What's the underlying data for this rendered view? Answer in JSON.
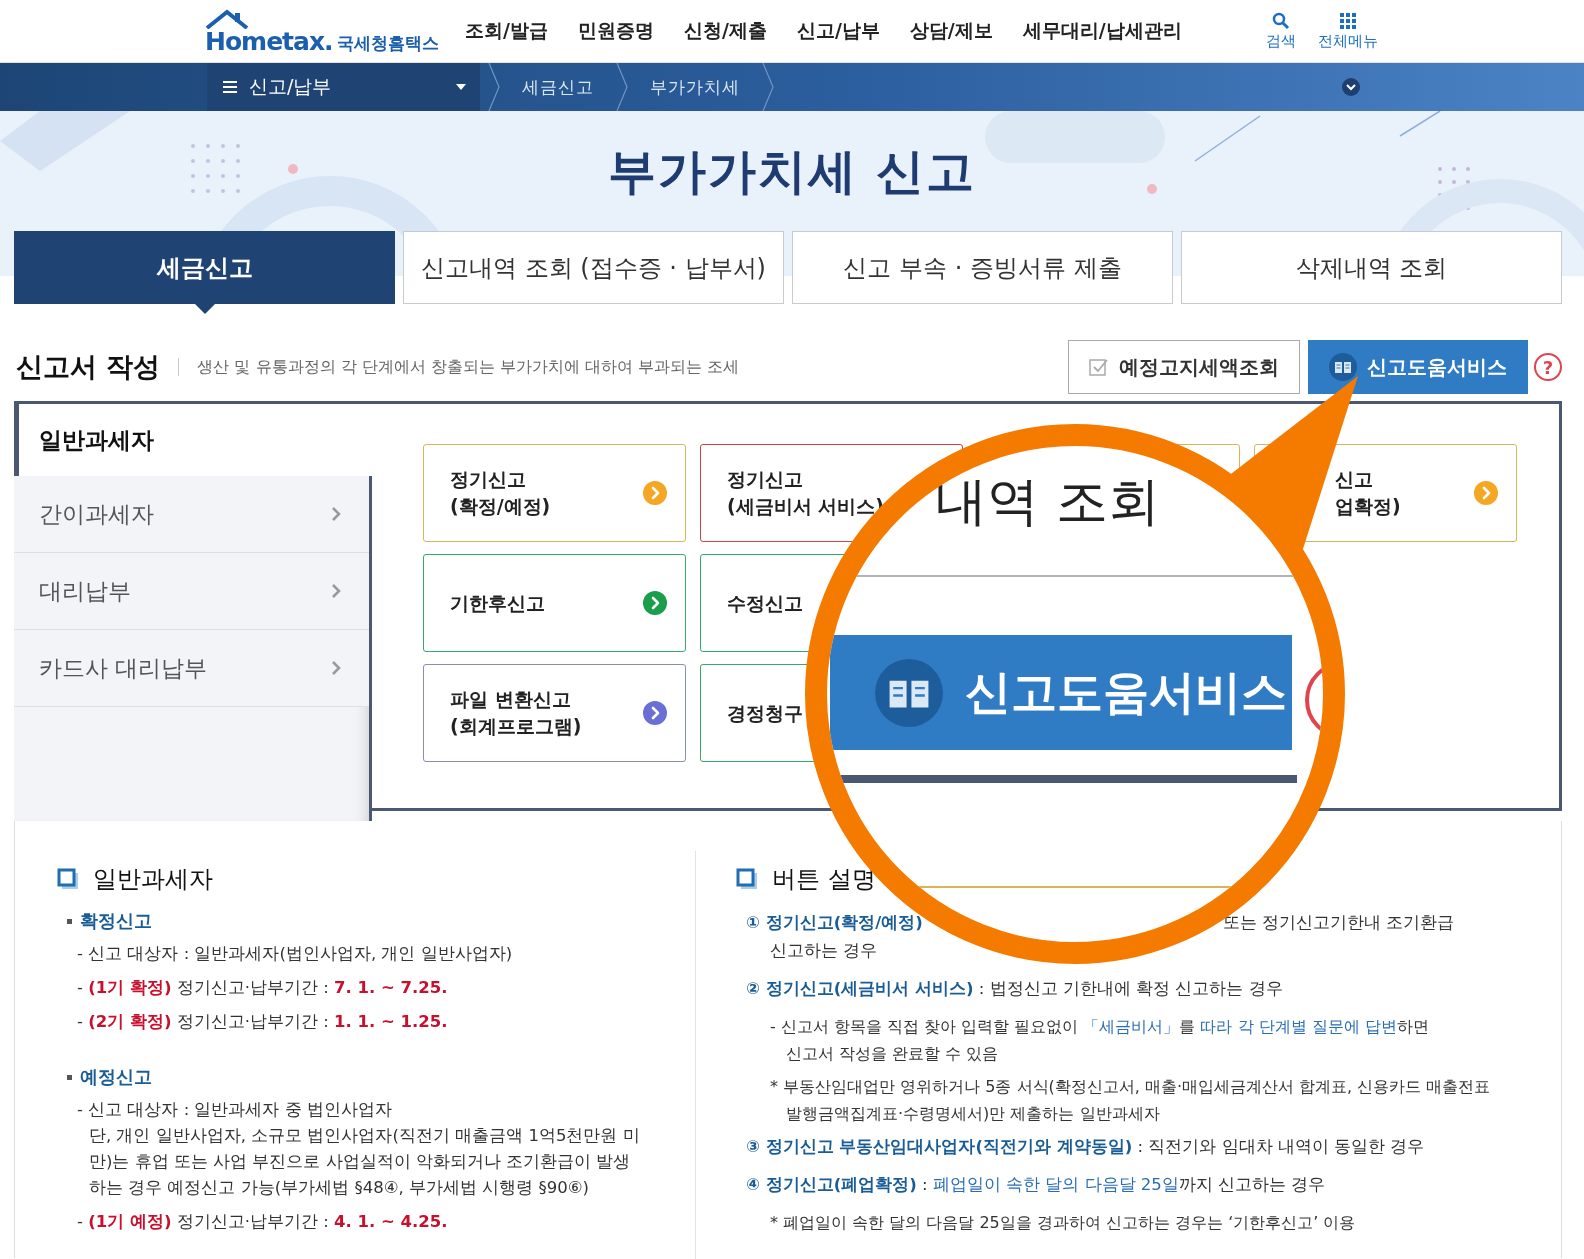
{
  "header": {
    "logo": {
      "brand": "Hometax.",
      "name": "국세청홈택스"
    },
    "nav": [
      "조회/발급",
      "민원증명",
      "신청/제출",
      "신고/납부",
      "상담/제보",
      "세무대리/납세관리"
    ],
    "utilities": [
      {
        "label": "검색",
        "kind": "search"
      },
      {
        "label": "전체메뉴",
        "kind": "menu"
      }
    ]
  },
  "breadcrumb": {
    "menu": "신고/납부",
    "items": [
      "세금신고",
      "부가가치세"
    ]
  },
  "title": "부가가치세 신고",
  "tabs": [
    {
      "label": "세금신고",
      "selected": true
    },
    {
      "label": "신고내역 조회 (접수증 · 납부서)",
      "selected": false
    },
    {
      "label": "신고 부속 · 증빙서류 제출",
      "selected": false
    },
    {
      "label": "삭제내역 조회",
      "selected": false
    }
  ],
  "section": {
    "title": "신고서 작성",
    "description": "생산 및 유통과정의 각 단계에서 창출되는 부가가치에 대하여 부과되는 조세",
    "buttons": [
      {
        "label": "예정고지세액조회",
        "kind": "outline"
      },
      {
        "label": "신고도움서비스",
        "kind": "primary"
      }
    ],
    "help": "?"
  },
  "taxpayer_types": [
    {
      "label": "일반과세자",
      "selected": true
    },
    {
      "label": "간이과세자",
      "selected": false
    },
    {
      "label": "대리납부",
      "selected": false
    },
    {
      "label": "카드사 대리납부",
      "selected": false
    }
  ],
  "filing_cards": [
    [
      {
        "kind": "full",
        "lines": [
          "정기신고",
          "(확정/예정)"
        ],
        "color": "#d9b45a",
        "arrow": {
          "color": "#f5a623"
        }
      },
      {
        "kind": "full",
        "lines": [
          "정기신고",
          "(세금비서 서비스)"
        ],
        "color": "#c9444a"
      },
      {
        "kind": "full",
        "color": "#d9b45a"
      },
      {
        "kind": "partial",
        "lines": [
          "신고",
          "업확정)"
        ],
        "color": "#d9b45a",
        "arrow": {
          "color": "#f5a623"
        }
      }
    ],
    [
      {
        "kind": "full",
        "lines": [
          "기한후신고"
        ],
        "color": "#3aa76d",
        "arrow": {
          "color": "#1a9e4b"
        }
      },
      {
        "kind": "full",
        "lines": [
          "수정신고"
        ],
        "color": "#3aa76d"
      }
    ],
    [
      {
        "kind": "full",
        "lines": [
          "파일 변환신고",
          "(회계프로그램)"
        ],
        "color": "#8a8fb0",
        "arrow": {
          "color": "#6a6fd6"
        }
      },
      {
        "kind": "full",
        "lines": [
          "경정청구"
        ],
        "color": "#3aa76d"
      }
    ]
  ],
  "guide_left": {
    "heading": "일반과세자",
    "groups": [
      {
        "title": "확정신고",
        "items": [
          {
            "segments": [
              {
                "text": "- 신고 대상자 : 일반과세자(법인사업자, 개인 일반사업자)",
                "kind": "plain"
              }
            ]
          },
          {
            "segments": [
              {
                "text": "- ",
                "kind": "plain"
              },
              {
                "text": "(1기 확정)",
                "kind": "emphasis"
              },
              {
                "text": " 정기신고·납부기간 : ",
                "kind": "plain"
              },
              {
                "text": "7. 1. ~ 7.25.",
                "kind": "emphasis"
              }
            ]
          },
          {
            "segments": [
              {
                "text": "- ",
                "kind": "plain"
              },
              {
                "text": "(2기 확정)",
                "kind": "emphasis"
              },
              {
                "text": " 정기신고·납부기간 : ",
                "kind": "plain"
              },
              {
                "text": "1. 1. ~ 1.25.",
                "kind": "emphasis"
              }
            ]
          }
        ]
      },
      {
        "title": "예정신고",
        "items": [
          {
            "segments": [
              {
                "text": "- 신고 대상자 : 일반과세자 중 법인사업자",
                "kind": "plain"
              }
            ],
            "continuation": "단, 개인 일반사업자, 소규모 법인사업자(직전기 매출금액 1억5천만원 미만)는 휴업 또는 사업 부진으로 사업실적이 악화되거나 조기환급이 발생하는 경우 예정신고 가능(부가세법 §48④, 부가세법 시행령 §90⑥)"
          },
          {
            "segments": [
              {
                "text": "- ",
                "kind": "plain"
              },
              {
                "text": "(1기 예정)",
                "kind": "emphasis"
              },
              {
                "text": " 정기신고·납부기간 : ",
                "kind": "plain"
              },
              {
                "text": "4. 1. ~ 4.25.",
                "kind": "emphasis"
              }
            ]
          }
        ]
      }
    ]
  },
  "guide_right": {
    "heading": "버튼 설명",
    "items": [
      {
        "segments": [
          {
            "text": "① 정기신고(확정/예정)",
            "kind": "label"
          }
        ],
        "visible_tail": "또는 정기신고기한내 조기환급",
        "continuation": "신고하는 경우"
      },
      {
        "segments": [
          {
            "text": "② 정기신고(세금비서 서비스)",
            "kind": "label"
          },
          {
            "text": " : 법정신고 기한내에 확정 신고하는 경우",
            "kind": "plain"
          }
        ],
        "notes": [
          {
            "segments": [
              {
                "text": "- 신고서 항목을 직접 찾아 입력할 필요없이 ",
                "kind": "plain"
              },
              {
                "text": "「세금비서」",
                "kind": "link"
              },
              {
                "text": "를 ",
                "kind": "plain"
              },
              {
                "text": "따라 각 단계별 질문에 답변",
                "kind": "link"
              },
              {
                "text": "하면",
                "kind": "plain"
              }
            ],
            "continuation": "신고서 작성을 완료할 수 있음"
          },
          {
            "segments": [
              {
                "text": "* 부동산임대업만 영위하거나 5종 서식(확정신고서, 매출·매입세금계산서 합계표, 신용카드 매출전표",
                "kind": "plain"
              }
            ],
            "continuation": "발행금액집계표·수령명세서)만 제출하는 일반과세자"
          }
        ]
      },
      {
        "segments": [
          {
            "text": "③ 정기신고 부동산임대사업자(직전기와 계약동일)",
            "kind": "label"
          },
          {
            "text": " : 직전기와 임대차 내역이 동일한 경우",
            "kind": "plain"
          }
        ]
      },
      {
        "segments": [
          {
            "text": "④ 정기신고(폐업확정)",
            "kind": "label"
          },
          {
            "text": " : ",
            "kind": "plain"
          },
          {
            "text": "폐업일이 속한 달의 다음달 25일",
            "kind": "link"
          },
          {
            "text": "까지 신고하는 경우",
            "kind": "plain"
          }
        ],
        "notes": [
          {
            "segments": [
              {
                "text": "* 폐업일이 속한 달의 다음달 25일을 경과하여 신고하는 경우는 ‘기한후신고’ 이용",
                "kind": "plain"
              }
            ]
          }
        ]
      }
    ]
  },
  "magnifier": {
    "heading_fragment": "내역 조회",
    "button": "신고도움서비스"
  }
}
